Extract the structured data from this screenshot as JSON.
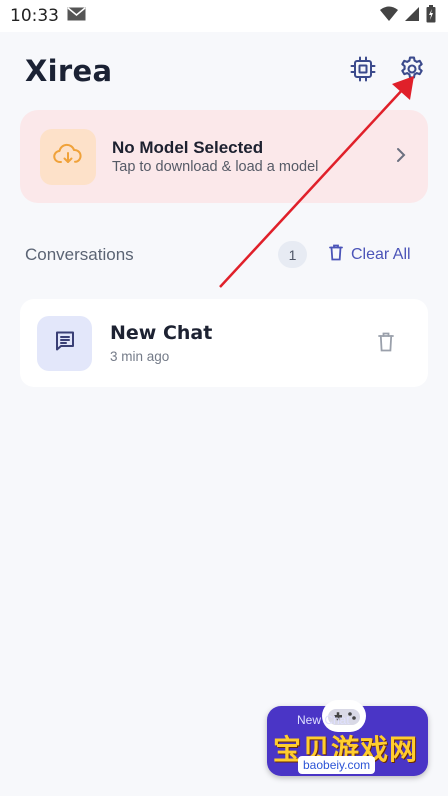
{
  "status_bar": {
    "time": "10:33"
  },
  "header": {
    "title": "Xirea"
  },
  "model_card": {
    "title": "No Model Selected",
    "subtitle": "Tap to download & load a model"
  },
  "conversations": {
    "label": "Conversations",
    "count": "1",
    "clear_all_label": "Clear All",
    "items": [
      {
        "title": "New Chat",
        "time": "3 min ago"
      }
    ]
  },
  "watermark": {
    "overlay_text": "New Chat",
    "site_name_cn": "宝贝游戏网",
    "url": "baobeiy.com"
  },
  "colors": {
    "background": "#f7f8fb",
    "model_card_bg": "#fbe8ea",
    "model_icon_bg": "#fde1c9",
    "model_icon_color": "#f0a23a",
    "chat_icon_bg": "#e3e7fa",
    "accent": "#4b54b8",
    "annotation_arrow": "#e0202a"
  },
  "icons": {
    "header_left": "chip-icon",
    "header_right": "gear-icon",
    "model": "cloud-download-icon",
    "model_action": "chevron-right-icon",
    "clear_all": "trash-icon",
    "chat": "message-icon",
    "chat_action": "trash-icon"
  }
}
